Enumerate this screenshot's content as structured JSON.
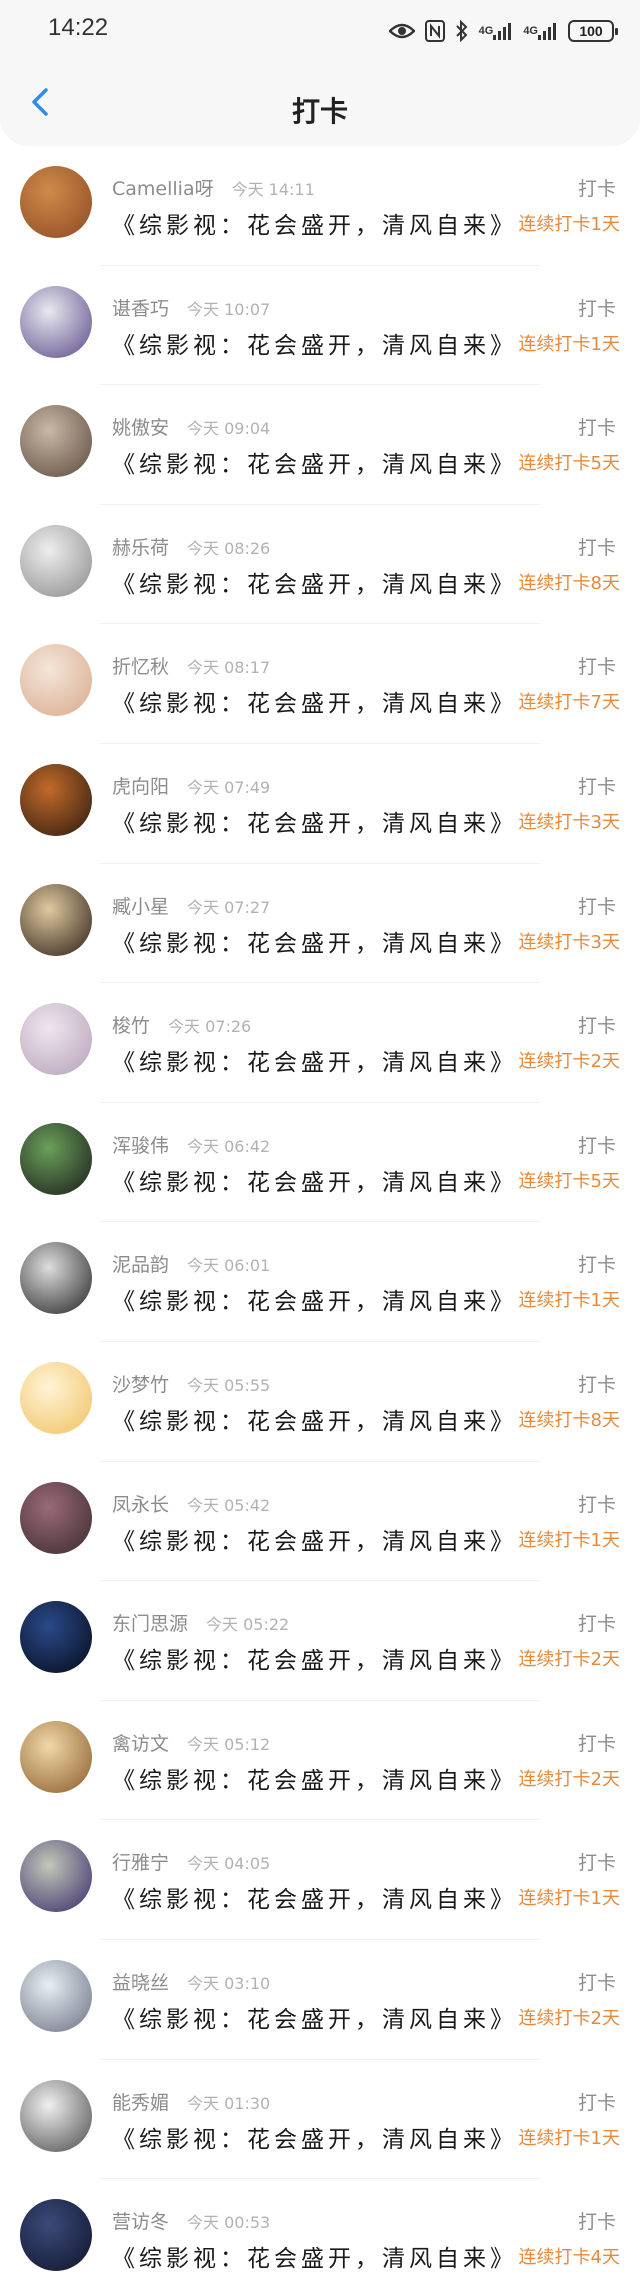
{
  "status": {
    "time": "14:22",
    "signal1": "4G",
    "signal2": "4G",
    "battery": "100"
  },
  "header": {
    "title": "打卡"
  },
  "colors": {
    "accent": "#e58a3c",
    "back": "#2d8cf0"
  },
  "entries": [
    {
      "name": "Camellia呀",
      "time": "今天 14:11",
      "book": "《综影视：花会盛开，清风自来》",
      "action": "打卡",
      "streak": "连续打卡1天",
      "avatar": [
        "#d08a4a",
        "#8b4a22"
      ]
    },
    {
      "name": "谌香巧",
      "time": "今天 10:07",
      "book": "《综影视：花会盛开，清风自来》",
      "action": "打卡",
      "streak": "连续打卡1天",
      "avatar": [
        "#e8e8ef",
        "#5a4a8a"
      ]
    },
    {
      "name": "姚傲安",
      "time": "今天 09:04",
      "book": "《综影视：花会盛开，清风自来》",
      "action": "打卡",
      "streak": "连续打卡5天",
      "avatar": [
        "#c9b8a6",
        "#5a4a3c"
      ]
    },
    {
      "name": "赫乐荷",
      "time": "今天 08:26",
      "book": "《综影视：花会盛开，清风自来》",
      "action": "打卡",
      "streak": "连续打卡8天",
      "avatar": [
        "#eeeeee",
        "#8a8a8a"
      ]
    },
    {
      "name": "折忆秋",
      "time": "今天 08:17",
      "book": "《综影视：花会盛开，清风自来》",
      "action": "打卡",
      "streak": "连续打卡7天",
      "avatar": [
        "#f4e6da",
        "#d9a98a"
      ]
    },
    {
      "name": "虎向阳",
      "time": "今天 07:49",
      "book": "《综影视：花会盛开，清风自来》",
      "action": "打卡",
      "streak": "连续打卡3天",
      "avatar": [
        "#c26a2a",
        "#2a1a10"
      ]
    },
    {
      "name": "臧小星",
      "time": "今天 07:27",
      "book": "《综影视：花会盛开，清风自来》",
      "action": "打卡",
      "streak": "连续打卡3天",
      "avatar": [
        "#e0c9a0",
        "#2a1e14"
      ]
    },
    {
      "name": "梭竹",
      "time": "今天 07:26",
      "book": "《综影视：花会盛开，清风自来》",
      "action": "打卡",
      "streak": "连续打卡2天",
      "avatar": [
        "#f0e6ee",
        "#b4a0b8"
      ]
    },
    {
      "name": "浑骏伟",
      "time": "今天 06:42",
      "book": "《综影视：花会盛开，清风自来》",
      "action": "打卡",
      "streak": "连续打卡5天",
      "avatar": [
        "#6aa05a",
        "#1a1a1a"
      ]
    },
    {
      "name": "泥品韵",
      "time": "今天 06:01",
      "book": "《综影视：花会盛开，清风自来》",
      "action": "打卡",
      "streak": "连续打卡1天",
      "avatar": [
        "#dddddd",
        "#222222"
      ]
    },
    {
      "name": "沙梦竹",
      "time": "今天 05:55",
      "book": "《综影视：花会盛开，清风自来》",
      "action": "打卡",
      "streak": "连续打卡8天",
      "avatar": [
        "#fff4d6",
        "#f0c060"
      ]
    },
    {
      "name": "凤永长",
      "time": "今天 05:42",
      "book": "《综影视：花会盛开，清风自来》",
      "action": "打卡",
      "streak": "连续打卡1天",
      "avatar": [
        "#9a6a7a",
        "#3a2a2a"
      ]
    },
    {
      "name": "东门思源",
      "time": "今天 05:22",
      "book": "《综影视：花会盛开，清风自来》",
      "action": "打卡",
      "streak": "连续打卡2天",
      "avatar": [
        "#2a4a8a",
        "#050a18"
      ]
    },
    {
      "name": "禽访文",
      "time": "今天 05:12",
      "book": "《综影视：花会盛开，清风自来》",
      "action": "打卡",
      "streak": "连续打卡2天",
      "avatar": [
        "#f0d8a8",
        "#8a5a2a"
      ]
    },
    {
      "name": "行雅宁",
      "time": "今天 04:05",
      "book": "《综影视：花会盛开，清风自来》",
      "action": "打卡",
      "streak": "连续打卡1天",
      "avatar": [
        "#c0c8b8",
        "#3a2a6a"
      ]
    },
    {
      "name": "益晓丝",
      "time": "今天 03:10",
      "book": "《综影视：花会盛开，清风自来》",
      "action": "打卡",
      "streak": "连续打卡2天",
      "avatar": [
        "#e8eef4",
        "#6a7080"
      ]
    },
    {
      "name": "能秀媚",
      "time": "今天 01:30",
      "book": "《综影视：花会盛开，清风自来》",
      "action": "打卡",
      "streak": "连续打卡1天",
      "avatar": [
        "#f0f0f0",
        "#4a4a4a"
      ]
    },
    {
      "name": "营访冬",
      "time": "今天 00:53",
      "book": "《综影视：花会盛开，清风自来》",
      "action": "打卡",
      "streak": "连续打卡4天",
      "avatar": [
        "#3a4a7a",
        "#10142a"
      ]
    }
  ]
}
